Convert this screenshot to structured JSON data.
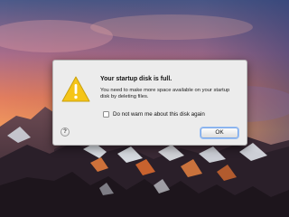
{
  "wallpaper": {
    "name": "macos-sierra-mountain-wallpaper"
  },
  "alert": {
    "icon": "warning-triangle-icon",
    "title": "Your startup disk is full.",
    "message": "You need to make more space available on your startup disk by deleting files.",
    "suppress_checkbox": {
      "checked": false,
      "label": "Do not warn me about this disk again"
    },
    "help_label": "?",
    "ok_label": "OK"
  },
  "colors": {
    "warning_yellow": "#f5c518",
    "default_button_ring": "#7aa7e8",
    "dialog_background": "#ececec"
  }
}
